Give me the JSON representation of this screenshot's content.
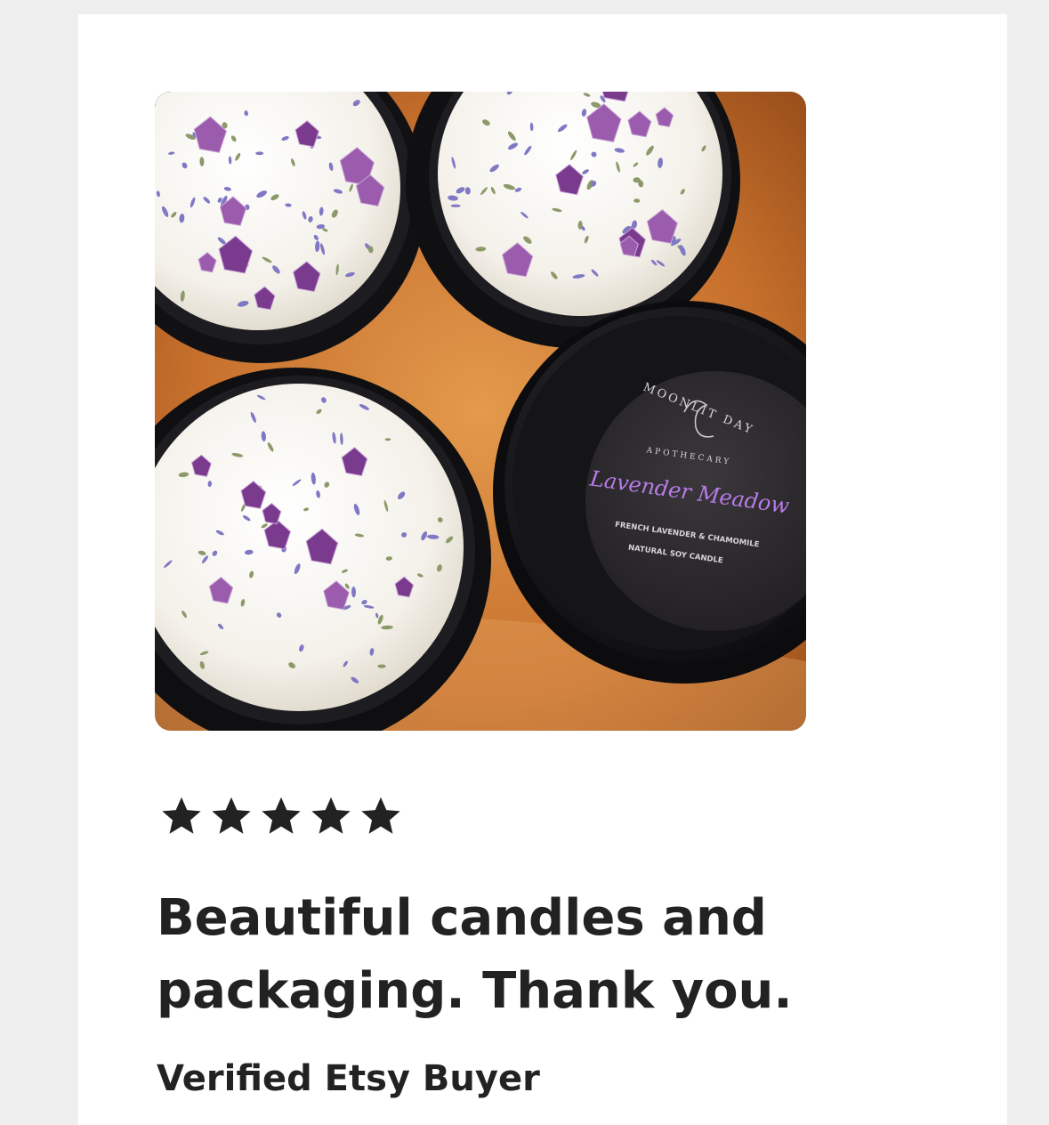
{
  "review": {
    "rating": 5,
    "rating_max": 5,
    "title_line1": "Beautiful candles and",
    "title_line2": "packaging. Thank you.",
    "reviewer": "Verified Etsy Buyer"
  },
  "photo": {
    "label": {
      "brand_top": "MOONLIT DAY",
      "brand_bottom": "APOTHECARY",
      "scent_script": "Lavender Meadow",
      "line1": "FRENCH LAVENDER & CHAMOMILE",
      "line2": "NATURAL SOY CANDLE"
    }
  },
  "colors": {
    "page_bg": "#efefef",
    "card_bg": "#ffffff",
    "text": "#222222",
    "star": "#222222",
    "label_accent": "#b77be8"
  },
  "icons": {
    "star": "star-icon"
  }
}
